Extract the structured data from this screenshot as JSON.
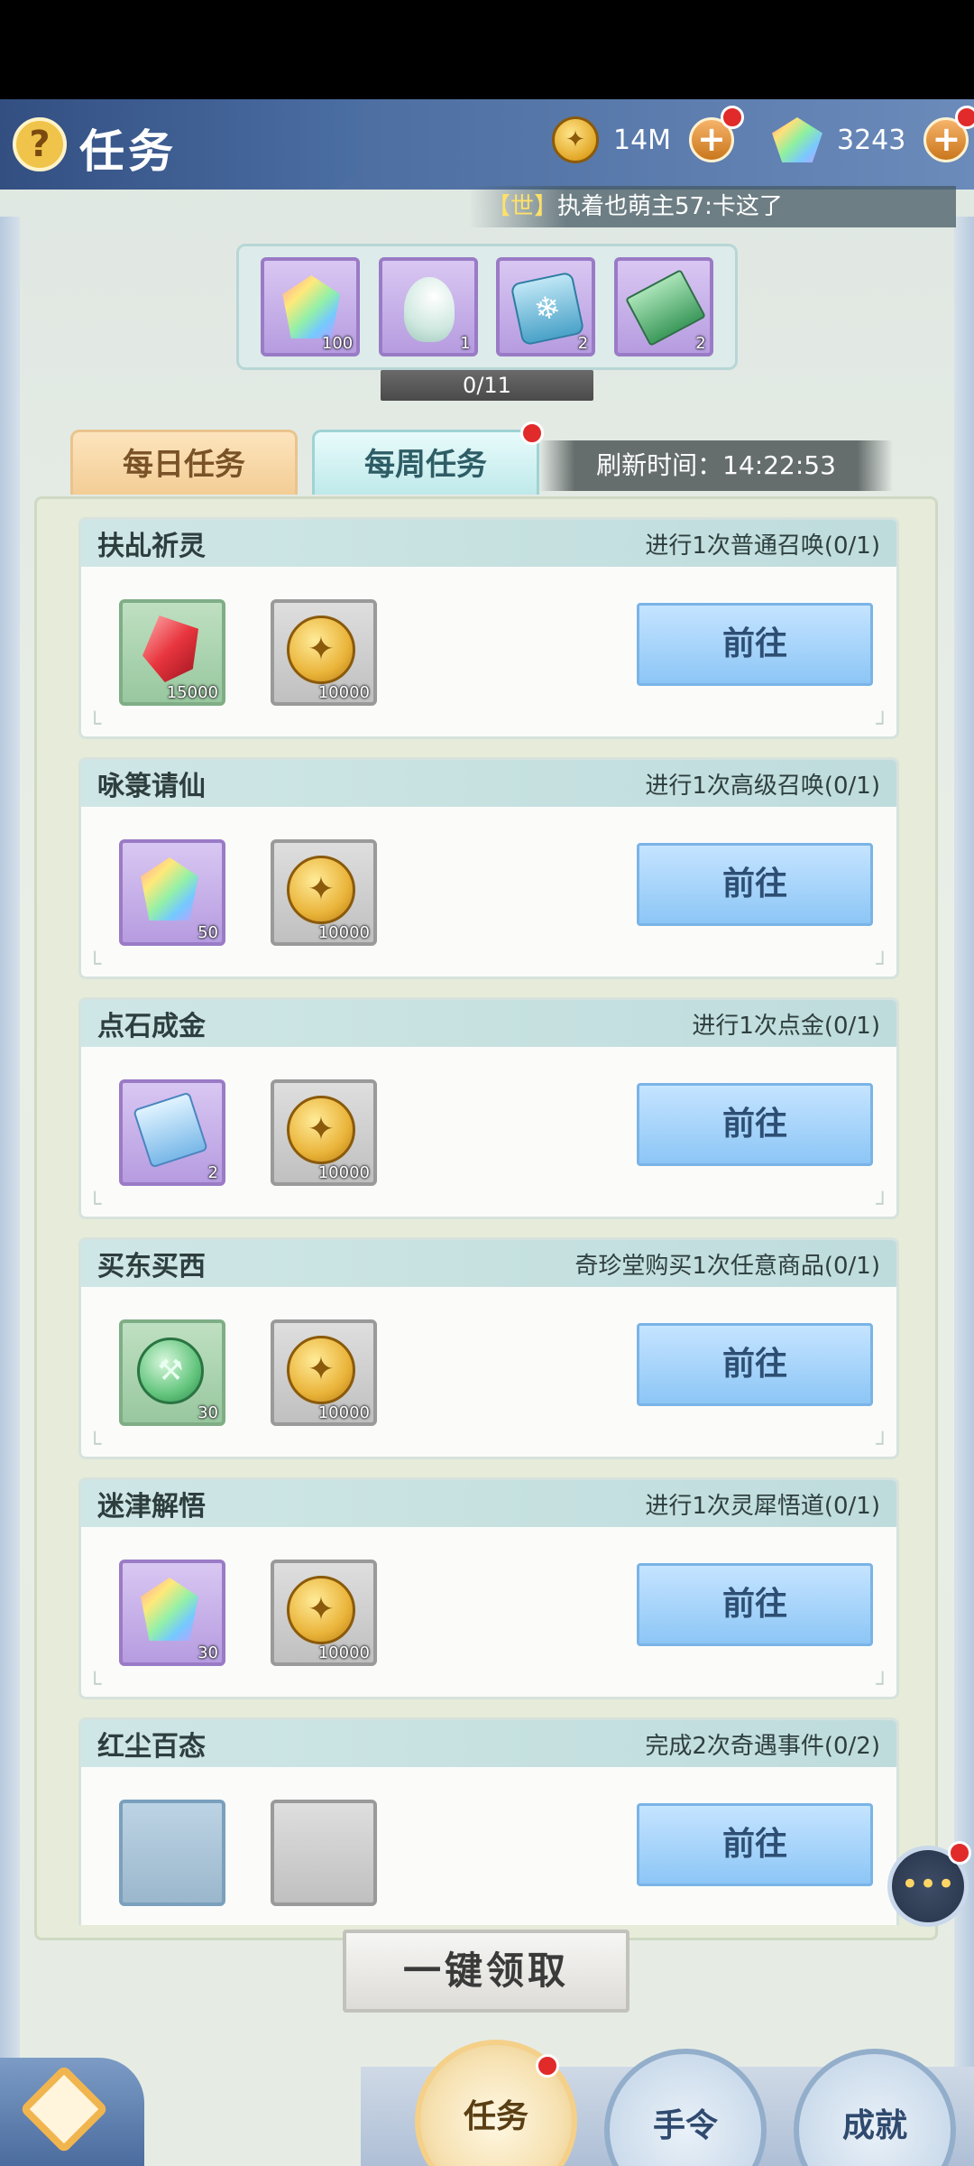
{
  "header": {
    "help_icon": "?",
    "title": "任务",
    "coins": "14M",
    "gems": "3243",
    "ticker_tag": "【世】",
    "ticker_text": "执着也萌主57:卡这了"
  },
  "progress": {
    "rewards": [
      {
        "icon": "rainbow-gem",
        "count": "100"
      },
      {
        "icon": "spoon",
        "count": "1"
      },
      {
        "icon": "snowflake-charm",
        "count": "2"
      },
      {
        "icon": "green-ticket",
        "count": "2"
      }
    ],
    "value_text": "0/11",
    "fraction": 0
  },
  "tabs": {
    "daily": "每日任务",
    "weekly": "每周任务",
    "refresh_label": "刷新时间：",
    "refresh_time": "14:22:53"
  },
  "tasks": [
    {
      "name": "扶乩祈灵",
      "condition": "进行1次普通召唤(0/1)",
      "rewards": [
        {
          "icon": "red-crystal",
          "count": "15000"
        },
        {
          "icon": "gold-coin",
          "count": "10000"
        }
      ],
      "button": "前往"
    },
    {
      "name": "咏箓请仙",
      "condition": "进行1次高级召唤(0/1)",
      "rewards": [
        {
          "icon": "rainbow-gem",
          "count": "50"
        },
        {
          "icon": "gold-coin",
          "count": "10000"
        }
      ],
      "button": "前往"
    },
    {
      "name": "点石成金",
      "condition": "进行1次点金(0/1)",
      "rewards": [
        {
          "icon": "blue-ticket",
          "count": "2"
        },
        {
          "icon": "gold-coin",
          "count": "10000"
        }
      ],
      "button": "前往"
    },
    {
      "name": "买东买西",
      "condition": "奇珍堂购买1次任意商品(0/1)",
      "rewards": [
        {
          "icon": "jade-token",
          "count": "30"
        },
        {
          "icon": "gold-coin",
          "count": "10000"
        }
      ],
      "button": "前往"
    },
    {
      "name": "迷津解悟",
      "condition": "进行1次灵犀悟道(0/1)",
      "rewards": [
        {
          "icon": "rainbow-gem",
          "count": "30"
        },
        {
          "icon": "gold-coin",
          "count": "10000"
        }
      ],
      "button": "前往"
    },
    {
      "name": "红尘百态",
      "condition": "完成2次奇遇事件(0/2)",
      "rewards": [],
      "button": "前往"
    }
  ],
  "bottom": {
    "claim_all": "一键领取",
    "nav_task": "任务",
    "nav_order": "手令",
    "nav_achievement": "成就",
    "chat_icon": "•••"
  },
  "colors": {
    "header": "#4b6ea3",
    "go_button": "#8cc6f6",
    "badge": "#e12a2a"
  }
}
